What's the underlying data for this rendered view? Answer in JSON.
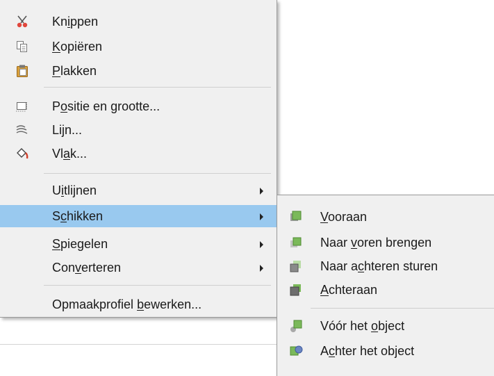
{
  "context_menu": {
    "items": [
      {
        "id": "cut",
        "pre": "Kn",
        "u": "i",
        "post": "ppen",
        "icon": "scissors-icon"
      },
      {
        "id": "copy",
        "pre": "",
        "u": "K",
        "post": "opiëren",
        "icon": "copy-icon"
      },
      {
        "id": "paste",
        "pre": "",
        "u": "P",
        "post": "lakken",
        "icon": "paste-icon"
      },
      {
        "id": "position",
        "pre": "P",
        "u": "o",
        "post": "sitie en grootte...",
        "icon": "position-size-icon"
      },
      {
        "id": "line",
        "pre": "Lijn...",
        "u": "",
        "post": "",
        "icon": "line-icon"
      },
      {
        "id": "area",
        "pre": "Vl",
        "u": "a",
        "post": "k...",
        "icon": "fill-bucket-icon"
      },
      {
        "id": "align",
        "pre": "U",
        "u": "i",
        "post": "tlijnen",
        "submenu": true
      },
      {
        "id": "arrange",
        "pre": "S",
        "u": "c",
        "post": "hikken",
        "submenu": true,
        "highlighted": true
      },
      {
        "id": "flip",
        "pre": "",
        "u": "S",
        "post": "piegelen",
        "submenu": true
      },
      {
        "id": "convert",
        "pre": "Con",
        "u": "v",
        "post": "erteren",
        "submenu": true
      },
      {
        "id": "edit_style",
        "pre": "Opmaakprofiel ",
        "u": "b",
        "post": "ewerken..."
      }
    ]
  },
  "arrange_submenu": {
    "items": [
      {
        "id": "bring_front",
        "pre": "",
        "u": "V",
        "post": "ooraan",
        "icon": "bring-to-front-icon"
      },
      {
        "id": "bring_forward",
        "pre": "Naar ",
        "u": "v",
        "post": "oren brengen",
        "icon": "bring-forward-icon"
      },
      {
        "id": "send_backward",
        "pre": "Naar a",
        "u": "c",
        "post": "hteren sturen",
        "icon": "send-backward-icon"
      },
      {
        "id": "send_back",
        "pre": "",
        "u": "A",
        "post": "chteraan",
        "icon": "send-to-back-icon"
      },
      {
        "id": "in_front_object",
        "pre": "Vóór het ",
        "u": "o",
        "post": "bject",
        "icon": "in-front-of-object-icon"
      },
      {
        "id": "behind_object",
        "pre": "A",
        "u": "c",
        "post": "hter het object",
        "icon": "behind-object-icon"
      }
    ]
  },
  "colors": {
    "highlight": "#99c9ef",
    "menu_bg": "#f0f0f0",
    "icon_green": "#7bb95a",
    "icon_gray": "#6e6e6e"
  }
}
